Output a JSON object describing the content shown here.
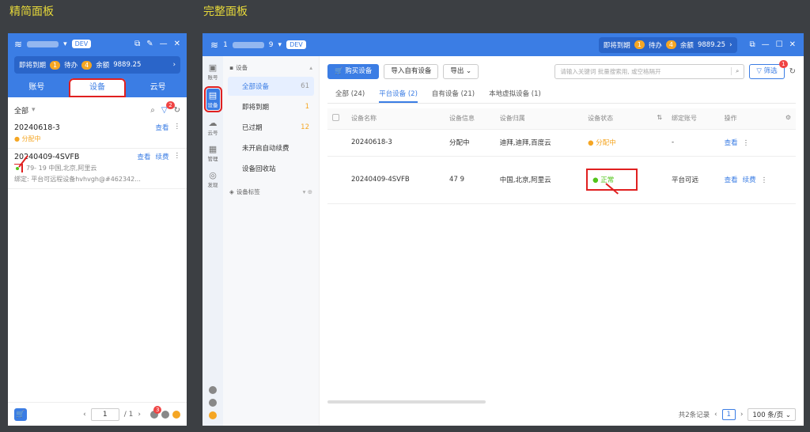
{
  "captions": {
    "simple": "精简面板",
    "full": "完整面板"
  },
  "simple": {
    "title_suffix": "",
    "dev_tag": "DEV",
    "info": {
      "expiring_label": "即将到期",
      "expiring_count": "1",
      "todo_label": "待办",
      "todo_count": "4",
      "balance_label": "余额",
      "balance_value": "9889.25"
    },
    "tabs": [
      "账号",
      "设备",
      "云号"
    ],
    "filter_label": "全部",
    "filter_badge": "2",
    "devices": [
      {
        "name": "20240618-3",
        "status": "分配中",
        "ops": [
          "查看"
        ]
      },
      {
        "name": "20240409-4SVFB",
        "ops": [
          "查看",
          "续费"
        ],
        "sub": "79-        19  中国,北京,阿里云",
        "note": "绑定: 平台可远程设备hvhvgh@#462342..."
      }
    ],
    "pager": {
      "current": "1",
      "total": "/ 1",
      "notify_badge": "3"
    }
  },
  "full": {
    "title_prefix": "1",
    "title_suffix": "9",
    "dev_tag": "DEV",
    "info": {
      "expiring_label": "即将到期",
      "expiring_count": "1",
      "todo_label": "待办",
      "todo_count": "4",
      "balance_label": "余额",
      "balance_value": "9889.25"
    },
    "rail": [
      "账号",
      "设备",
      "云号",
      "管理",
      "发现"
    ],
    "categories": {
      "header": "设备",
      "items": [
        {
          "label": "全部设备",
          "count": "61"
        },
        {
          "label": "即将到期",
          "count": "1"
        },
        {
          "label": "已过期",
          "count": "12"
        },
        {
          "label": "未开启自动续费",
          "count": ""
        },
        {
          "label": "设备回收站",
          "count": ""
        }
      ],
      "tag_header": "设备标签"
    },
    "toolbar": {
      "buy": "购买设备",
      "import": "导入自有设备",
      "export": "导出",
      "search_placeholder": "请输入关键词 批量搜索用, 或空格隔开",
      "filter": "筛选",
      "filter_badge": "1"
    },
    "tabs": [
      "全部 (24)",
      "平台设备 (2)",
      "自有设备 (21)",
      "本地虚拟设备 (1)"
    ],
    "table": {
      "headers": [
        "设备名称",
        "设备信息",
        "设备归属",
        "设备状态",
        "绑定账号",
        "操作"
      ],
      "rows": [
        {
          "name": "20240618-3",
          "info": "分配中",
          "owner": "迪拜,迪拜,百度云",
          "status": "分配中",
          "bind": "-",
          "ops": [
            "查看"
          ]
        },
        {
          "name": "20240409-4SVFB",
          "info": "47            9",
          "owner": "中国,北京,阿里云",
          "status": "正常",
          "bind": "平台可远",
          "ops": [
            "查看",
            "续费"
          ]
        }
      ]
    },
    "footer": {
      "total": "共2条记录",
      "page": "1",
      "per_page": "100 条/页"
    }
  }
}
